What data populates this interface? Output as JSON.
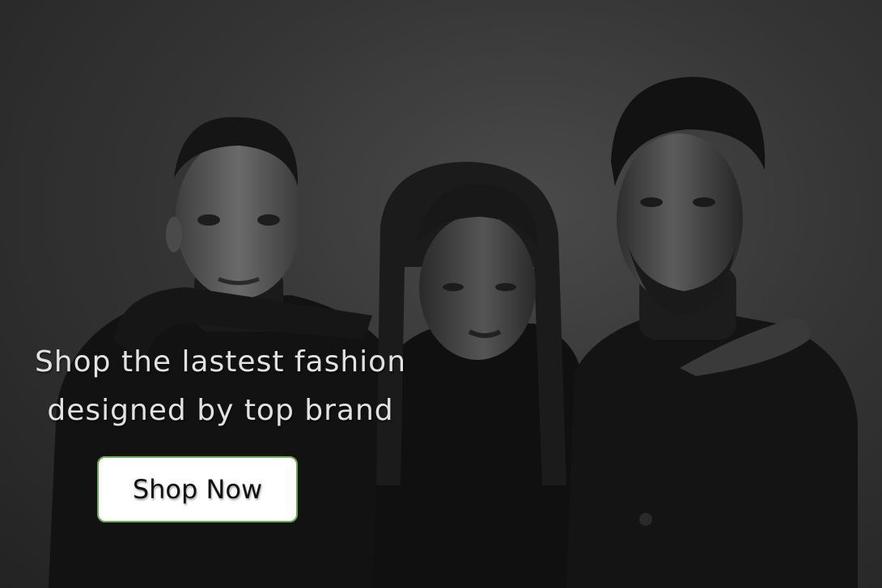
{
  "hero": {
    "headline_line1": "Shop the lastest fashion",
    "headline_line2": "designed by top brand",
    "cta_label": "Shop Now"
  },
  "colors": {
    "background": "#2b2b2b",
    "headline_text": "#e2e2e2",
    "button_background": "#ffffff",
    "button_border": "#6aa84f",
    "button_text": "#111111"
  }
}
